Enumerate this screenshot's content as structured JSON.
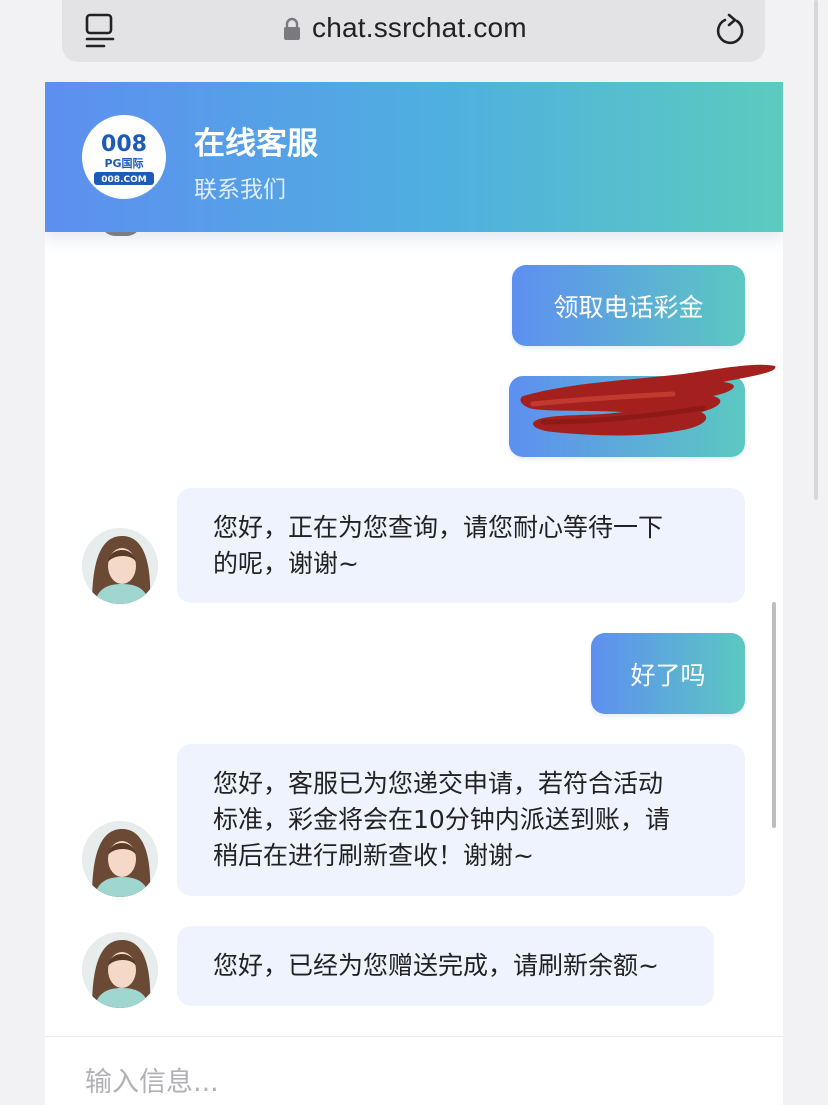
{
  "browser": {
    "url": "chat.ssrchat.com",
    "tabs_icon": "tabs-icon",
    "lock_icon": "lock-icon",
    "reload_icon": "reload-icon"
  },
  "header": {
    "title": "在线客服",
    "subtitle": "联系我们",
    "logo": {
      "top_text": "008",
      "middle_text": "PG国际",
      "bottom_text": "008.COM"
    },
    "gradient_start": "#5d8ff0",
    "gradient_end": "#5ccbbe"
  },
  "messages": [
    {
      "sender": "user",
      "text": "领取电话彩金"
    },
    {
      "sender": "user",
      "text": "",
      "redacted": true
    },
    {
      "sender": "agent",
      "lines": [
        "您好，正在为您查询，请您耐心等待一下",
        "的呢，谢谢~"
      ]
    },
    {
      "sender": "user",
      "text": "好了吗"
    },
    {
      "sender": "agent",
      "lines": [
        "您好，客服已为您递交申请，若符合活动",
        "标准，彩金将会在10分钟内派送到账，请",
        "稍后在进行刷新查收！谢谢~"
      ]
    },
    {
      "sender": "agent",
      "lines": [
        "您好，已经为您赠送完成，请刷新余额~"
      ]
    }
  ],
  "input": {
    "placeholder": "输入信息..."
  }
}
